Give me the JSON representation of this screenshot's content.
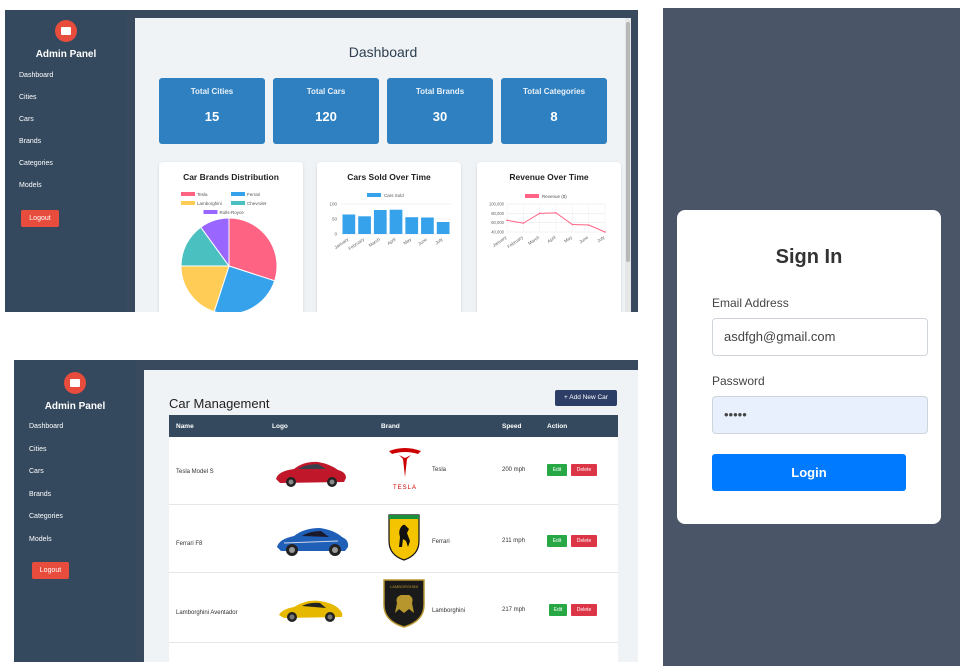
{
  "colors": {
    "sidebar": "#34495e",
    "stat_card": "#2e80c0",
    "logout": "#e74c3c",
    "login": "#007bff",
    "edit": "#28a745",
    "delete": "#dc3545"
  },
  "sidebar": {
    "title": "Admin Panel",
    "items": [
      {
        "label": "Dashboard"
      },
      {
        "label": "Cities"
      },
      {
        "label": "Cars"
      },
      {
        "label": "Brands"
      },
      {
        "label": "Categories"
      },
      {
        "label": "Models"
      }
    ],
    "logout": "Logout"
  },
  "dashboard": {
    "title": "Dashboard",
    "stats": [
      {
        "label": "Total Cities",
        "value": "15"
      },
      {
        "label": "Total Cars",
        "value": "120"
      },
      {
        "label": "Total Brands",
        "value": "30"
      },
      {
        "label": "Total Categories",
        "value": "8"
      }
    ],
    "cards": [
      {
        "title": "Car Brands Distribution"
      },
      {
        "title": "Cars Sold Over Time"
      },
      {
        "title": "Revenue Over Time"
      }
    ]
  },
  "chart_data": [
    {
      "type": "pie",
      "title": "Car Brands Distribution",
      "categories": [
        "Tesla",
        "Ferrari",
        "Lamborghini",
        "Chevrolet",
        "Rolls-Royce"
      ],
      "values": [
        30,
        25,
        20,
        15,
        10
      ],
      "colors": [
        "#ff6384",
        "#36a2eb",
        "#ffcd56",
        "#4bc0c0",
        "#9966ff"
      ],
      "legend": "top"
    },
    {
      "type": "bar",
      "title": "Cars Sold Over Time",
      "categories": [
        "January",
        "February",
        "March",
        "April",
        "May",
        "June",
        "July"
      ],
      "series": [
        {
          "name": "Cars Sold",
          "values": [
            65,
            59,
            80,
            81,
            56,
            55,
            40
          ]
        }
      ],
      "yticks": [
        "100",
        "50",
        "0"
      ],
      "ylim": [
        0,
        100
      ],
      "color": "#36a2eb",
      "legend": "top"
    },
    {
      "type": "line",
      "title": "Revenue Over Time",
      "categories": [
        "January",
        "February",
        "March",
        "April",
        "May",
        "June",
        "July"
      ],
      "series": [
        {
          "name": "Revenue ($)",
          "values": [
            65000,
            59000,
            80000,
            81000,
            56000,
            55000,
            40000
          ]
        }
      ],
      "yticks": [
        "100,000",
        "80,000",
        "60,000",
        "40,000"
      ],
      "ylim": [
        40000,
        100000
      ],
      "color": "#ff6384",
      "legend": "top"
    }
  ],
  "car_management": {
    "title": "Car Management",
    "add_button": "+ Add New Car",
    "columns": [
      "Name",
      "Logo",
      "Brand",
      "Speed",
      "Action"
    ],
    "rows": [
      {
        "name": "Tesla Model S",
        "brand": "Tesla",
        "speed": "200 mph",
        "logo_text": "TESLA",
        "car_color": "#c0182a"
      },
      {
        "name": "Ferrari F8",
        "brand": "Ferrari",
        "speed": "211 mph",
        "logo_text": "",
        "car_color": "#1f5fb8"
      },
      {
        "name": "Lamborghini Aventador",
        "brand": "Lamborghini",
        "speed": "217 mph",
        "logo_text": "LAMBORGHINI",
        "car_color": "#e6b800"
      }
    ],
    "edit": "Edit",
    "delete": "Delete"
  },
  "signin": {
    "title": "Sign In",
    "email_label": "Email Address",
    "email_value": "asdfgh@gmail.com",
    "password_label": "Password",
    "password_value": "•••••",
    "button": "Login"
  }
}
